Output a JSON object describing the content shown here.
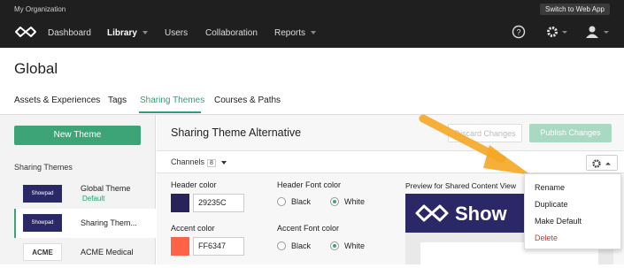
{
  "topbar": {
    "org": "My Organization",
    "switch_label": "Switch to Web App",
    "nav": [
      "Dashboard",
      "Library",
      "Users",
      "Collaboration",
      "Reports"
    ]
  },
  "page": {
    "title": "Global",
    "tabs": [
      "Assets & Experiences",
      "Tags",
      "Sharing Themes",
      "Courses & Paths"
    ],
    "active_tab": "Sharing Themes"
  },
  "sidebar": {
    "new_button": "New Theme",
    "section_label": "Sharing Themes",
    "themes": [
      {
        "name": "Global Theme",
        "badge": "Default",
        "thumb": "Showpad"
      },
      {
        "name": "Sharing Them...",
        "thumb": "Showpad"
      },
      {
        "name": "ACME Medical",
        "thumb": "ACME"
      }
    ]
  },
  "main": {
    "title": "Sharing Theme Alternative",
    "discard_label": "Discard Changes",
    "publish_label": "Publish Changes",
    "channels_label": "Channels",
    "channels_count": "8",
    "header_color_label": "Header color",
    "header_color_hex": "29235C",
    "header_color": "#29235C",
    "accent_color_label": "Accent color",
    "accent_color_hex": "FF6347",
    "accent_color": "#FF6347",
    "header_font_label": "Header Font color",
    "accent_font_label": "Accent Font color",
    "black_label": "Black",
    "white_label": "White",
    "header_font_value": "White",
    "accent_font_value": "White",
    "preview_label": "Preview for Shared Content View",
    "preview_brand": "Show"
  },
  "dropdown": {
    "items": [
      "Rename",
      "Duplicate",
      "Make Default",
      "Delete"
    ]
  },
  "colors": {
    "accent_green": "#3DA478",
    "annotation_arrow": "#F5A623"
  }
}
